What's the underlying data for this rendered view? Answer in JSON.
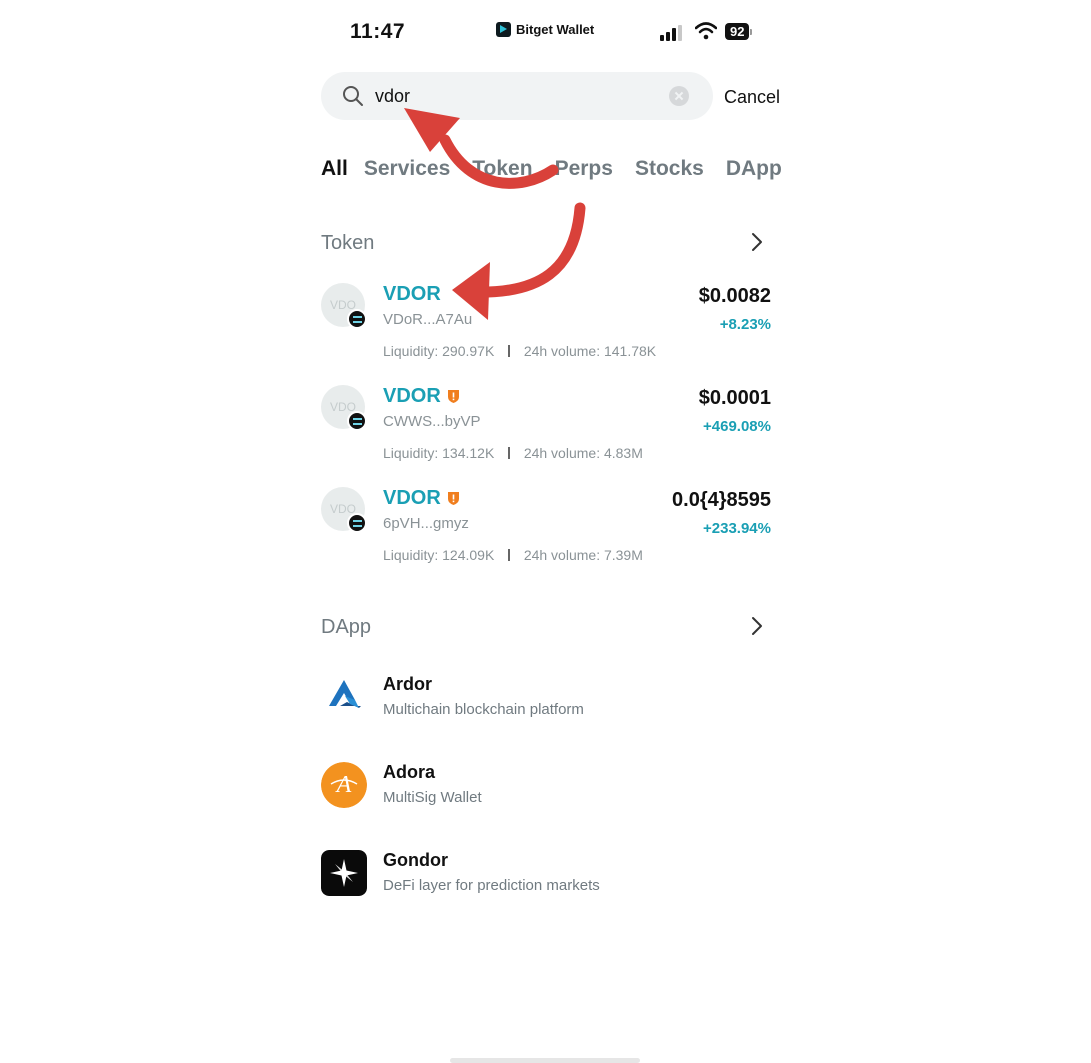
{
  "status_bar": {
    "time": "11:47",
    "brand": "Bitget Wallet",
    "battery": "92"
  },
  "search": {
    "value": "vdor",
    "placeholder": "",
    "cancel_label": "Cancel"
  },
  "tabs": [
    {
      "label": "All",
      "active": true
    },
    {
      "label": "Services"
    },
    {
      "label": "Token"
    },
    {
      "label": "Perps"
    },
    {
      "label": "Stocks"
    },
    {
      "label": "DApp"
    }
  ],
  "token_section": {
    "title": "Token",
    "tokens": [
      {
        "name": "VDOR",
        "avatar": "VDO",
        "address": "VDoR...A7Au",
        "liquidity": "Liquidity: 290.97K",
        "volume": "24h volume: 141.78K",
        "price": "$0.0082",
        "change": "+8.23%",
        "warning": false
      },
      {
        "name": "VDOR",
        "avatar": "VDO",
        "address": "CWWS...byVP",
        "liquidity": "Liquidity: 134.12K",
        "volume": "24h volume: 4.83M",
        "price": "$0.0001",
        "change": "+469.08%",
        "warning": true
      },
      {
        "name": "VDOR",
        "avatar": "VDO",
        "address": "6pVH...gmyz",
        "liquidity": "Liquidity: 124.09K",
        "volume": "24h volume: 7.39M",
        "price": "0.0{4}8595",
        "change": "+233.94%",
        "warning": true
      }
    ]
  },
  "dapp_section": {
    "title": "DApp",
    "dapps": [
      {
        "name": "Ardor",
        "description": "Multichain blockchain platform",
        "icon": "ardor-logo-icon"
      },
      {
        "name": "Adora",
        "description": "MultiSig Wallet",
        "icon": "adora-logo-icon"
      },
      {
        "name": "Gondor",
        "description": "DeFi layer for prediction markets",
        "icon": "gondor-logo-icon"
      }
    ]
  },
  "colors": {
    "accent": "#1a9fb4",
    "warning": "#f07e1e",
    "annotation_arrow": "#d9413a"
  }
}
